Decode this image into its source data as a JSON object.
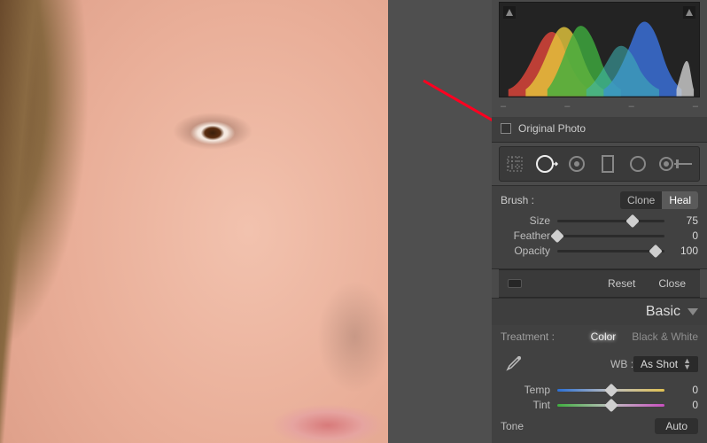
{
  "checkboxes": {
    "original_photo": "Original Photo"
  },
  "histogram": {
    "readout": [
      "–",
      "–",
      "–",
      "–"
    ]
  },
  "tools": [
    "crop-tool",
    "spot-removal-tool",
    "redeye-tool",
    "graduated-filter-tool",
    "radial-filter-tool",
    "adjustment-brush-tool"
  ],
  "brush": {
    "label": "Brush :",
    "modes": {
      "clone": "Clone",
      "heal": "Heal",
      "active": "heal"
    },
    "sliders": {
      "size": {
        "label": "Size",
        "value": 75,
        "pos": 70
      },
      "feather": {
        "label": "Feather",
        "value": 0,
        "pos": 0
      },
      "opacity": {
        "label": "Opacity",
        "value": 100,
        "pos": 92
      }
    },
    "reset": "Reset",
    "close": "Close"
  },
  "basic": {
    "title": "Basic",
    "treatment": {
      "label": "Treatment :",
      "color": "Color",
      "bw": "Black & White",
      "active": "color"
    },
    "wb": {
      "label": "WB :",
      "preset": "As Shot"
    },
    "temp": {
      "label": "Temp",
      "value": 0,
      "pos": 50
    },
    "tint": {
      "label": "Tint",
      "value": 0,
      "pos": 50
    },
    "tone": {
      "label": "Tone",
      "auto": "Auto"
    }
  }
}
